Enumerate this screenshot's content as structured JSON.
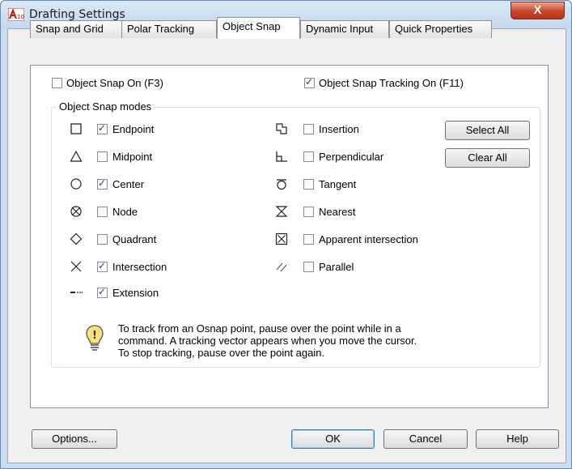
{
  "window": {
    "title": "Drafting Settings",
    "close_glyph": "X"
  },
  "tabs": [
    {
      "label": "Snap and Grid"
    },
    {
      "label": "Polar Tracking"
    },
    {
      "label": "Object Snap"
    },
    {
      "label": "Dynamic Input"
    },
    {
      "label": "Quick Properties"
    }
  ],
  "active_tab": "Object Snap",
  "object_snap_on": {
    "label": "Object Snap On (F3)",
    "checked": false
  },
  "object_snap_tracking_on": {
    "label": "Object Snap Tracking On (F11)",
    "checked": true
  },
  "snap_modes": {
    "group_label": "Object Snap modes",
    "left": [
      {
        "label": "Endpoint",
        "checked": true,
        "icon": "endpoint-icon"
      },
      {
        "label": "Midpoint",
        "checked": false,
        "icon": "midpoint-icon"
      },
      {
        "label": "Center",
        "checked": true,
        "icon": "center-icon"
      },
      {
        "label": "Node",
        "checked": false,
        "icon": "node-icon"
      },
      {
        "label": "Quadrant",
        "checked": false,
        "icon": "quadrant-icon"
      },
      {
        "label": "Intersection",
        "checked": true,
        "icon": "intersection-icon"
      },
      {
        "label": "Extension",
        "checked": true,
        "icon": "extension-icon"
      }
    ],
    "right": [
      {
        "label": "Insertion",
        "checked": false,
        "icon": "insertion-icon"
      },
      {
        "label": "Perpendicular",
        "checked": false,
        "icon": "perpendicular-icon"
      },
      {
        "label": "Tangent",
        "checked": false,
        "icon": "tangent-icon"
      },
      {
        "label": "Nearest",
        "checked": false,
        "icon": "nearest-icon"
      },
      {
        "label": "Apparent intersection",
        "checked": false,
        "icon": "apparent-intersection-icon"
      },
      {
        "label": "Parallel",
        "checked": false,
        "icon": "parallel-icon"
      }
    ],
    "select_all_label": "Select All",
    "clear_all_label": "Clear All"
  },
  "info_note": {
    "line1": "To track from an Osnap point, pause over the point while in a",
    "line2": "command.  A tracking vector appears when you move the cursor.",
    "line3": "To stop tracking, pause over the point again."
  },
  "footer": {
    "options_label": "Options...",
    "ok_label": "OK",
    "cancel_label": "Cancel",
    "help_label": "Help"
  },
  "colors": {
    "title_bar": "#c4d8ee",
    "close_button": "#c8452a",
    "check_mark": "#1f3f9c",
    "panel": "#ffffff"
  }
}
